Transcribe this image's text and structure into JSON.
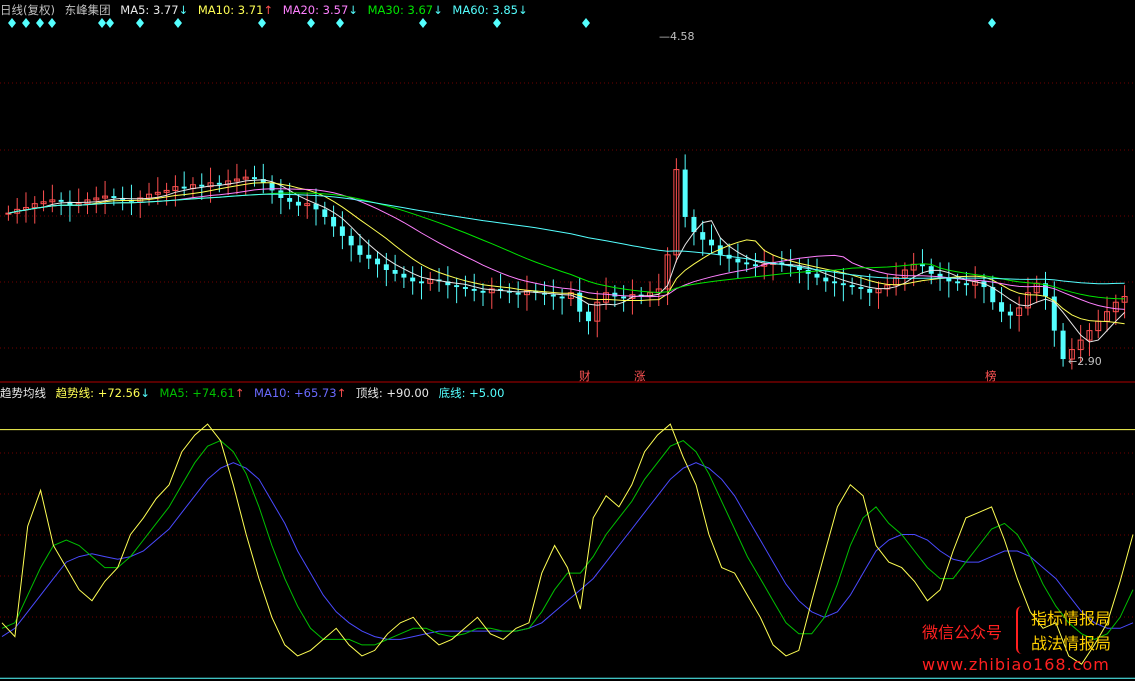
{
  "main_header": {
    "period": "日线(复权)",
    "stock_name": "东峰集团",
    "ma5_label": "MA5:",
    "ma5_value": "3.77",
    "ma5_arrow": "↓",
    "ma10_label": "MA10:",
    "ma10_value": "3.71",
    "ma10_arrow": "↑",
    "ma20_label": "MA20:",
    "ma20_value": "3.57",
    "ma20_arrow": "↓",
    "ma30_label": "MA30:",
    "ma30_value": "3.67",
    "ma30_arrow": "↓",
    "ma60_label": "MA60:",
    "ma60_value": "3.85",
    "ma60_arrow": "↓"
  },
  "indicator_header": {
    "name": "趋势均线",
    "trend_label": "趋势线:",
    "trend_value": "+72.56",
    "trend_arrow": "↓",
    "ma5_label": "MA5:",
    "ma5_value": "+74.61",
    "ma5_arrow": "↑",
    "ma10_label": "MA10:",
    "ma10_value": "+65.73",
    "ma10_arrow": "↑",
    "top_label": "顶线:",
    "top_value": "+90.00",
    "bottom_label": "底线:",
    "bottom_value": "+5.00"
  },
  "price_labels": {
    "high": "4.58",
    "low": "2.90"
  },
  "events": [
    {
      "label": "财"
    },
    {
      "label": "涨"
    },
    {
      "label": "榜"
    }
  ],
  "watermark": {
    "line1_prefix": "微信公众号",
    "line1_name": "指标情报局",
    "line2_name": "战法情报局",
    "url": "www.zhibiao168.com"
  },
  "colors": {
    "up": "#ff5050",
    "down": "#54ffff",
    "ma5": "#e8e8e8",
    "ma10": "#ffff54",
    "ma20": "#ff80ff",
    "ma30": "#00e600",
    "ma60": "#54ffff",
    "trend": "#ffff54",
    "trend_ma5": "#00c000",
    "trend_ma10": "#4a4aff",
    "panel_border": "#b00000",
    "grid": "#700000"
  },
  "chart_data": {
    "type": "candlestick",
    "price_high": 4.58,
    "price_low": 2.9,
    "indicator_top_line": 90,
    "indicator_bottom_line": 5,
    "candles_close": [
      3.72,
      3.74,
      3.75,
      3.77,
      3.78,
      3.79,
      3.78,
      3.76,
      3.77,
      3.79,
      3.8,
      3.81,
      3.8,
      3.79,
      3.78,
      3.8,
      3.82,
      3.83,
      3.84,
      3.86,
      3.85,
      3.87,
      3.86,
      3.88,
      3.87,
      3.89,
      3.9,
      3.91,
      3.9,
      3.88,
      3.84,
      3.8,
      3.78,
      3.76,
      3.77,
      3.74,
      3.7,
      3.65,
      3.6,
      3.55,
      3.5,
      3.48,
      3.45,
      3.42,
      3.4,
      3.38,
      3.36,
      3.35,
      3.37,
      3.36,
      3.34,
      3.33,
      3.32,
      3.31,
      3.3,
      3.32,
      3.31,
      3.3,
      3.29,
      3.31,
      3.3,
      3.29,
      3.28,
      3.27,
      3.3,
      3.2,
      3.15,
      3.25,
      3.3,
      3.28,
      3.27,
      3.29,
      3.28,
      3.3,
      3.32,
      3.5,
      3.95,
      3.7,
      3.62,
      3.58,
      3.55,
      3.5,
      3.48,
      3.46,
      3.45,
      3.44,
      3.45,
      3.46,
      3.45,
      3.44,
      3.42,
      3.4,
      3.38,
      3.36,
      3.35,
      3.34,
      3.33,
      3.32,
      3.3,
      3.32,
      3.34,
      3.38,
      3.42,
      3.45,
      3.44,
      3.4,
      3.38,
      3.36,
      3.35,
      3.34,
      3.36,
      3.33,
      3.25,
      3.2,
      3.18,
      3.22,
      3.3,
      3.35,
      3.28,
      3.1,
      2.95,
      3.0,
      3.05,
      3.1,
      3.15,
      3.2,
      3.25,
      3.28
    ],
    "trend_series": [
      20,
      15,
      55,
      68,
      48,
      40,
      32,
      28,
      35,
      40,
      52,
      58,
      65,
      70,
      82,
      88,
      92,
      86,
      70,
      52,
      36,
      22,
      12,
      8,
      10,
      14,
      18,
      12,
      8,
      10,
      16,
      20,
      22,
      16,
      12,
      14,
      18,
      22,
      16,
      14,
      18,
      20,
      38,
      48,
      40,
      25,
      58,
      66,
      62,
      70,
      82,
      88,
      92,
      80,
      70,
      52,
      40,
      38,
      30,
      22,
      12,
      8,
      10,
      28,
      45,
      62,
      70,
      66,
      48,
      42,
      40,
      35,
      28,
      32,
      46,
      58,
      60,
      62,
      50,
      36,
      24,
      18,
      20,
      8,
      5,
      12,
      20,
      35,
      52
    ],
    "trend_ma5_series": [
      18,
      20,
      30,
      40,
      48,
      50,
      48,
      44,
      40,
      40,
      44,
      50,
      56,
      62,
      70,
      78,
      84,
      86,
      82,
      74,
      62,
      48,
      36,
      26,
      18,
      14,
      14,
      14,
      12,
      12,
      14,
      16,
      18,
      18,
      16,
      15,
      16,
      18,
      18,
      17,
      17,
      18,
      24,
      32,
      38,
      38,
      44,
      52,
      58,
      64,
      72,
      78,
      84,
      86,
      82,
      74,
      64,
      54,
      44,
      36,
      28,
      20,
      16,
      16,
      22,
      34,
      48,
      58,
      62,
      56,
      52,
      46,
      40,
      36,
      36,
      42,
      48,
      54,
      56,
      52,
      44,
      34,
      26,
      20,
      16,
      14,
      16,
      22,
      32
    ],
    "trend_ma10_series": [
      15,
      18,
      24,
      30,
      36,
      42,
      44,
      45,
      44,
      43,
      44,
      46,
      50,
      54,
      60,
      66,
      72,
      76,
      78,
      76,
      72,
      64,
      56,
      46,
      38,
      30,
      24,
      20,
      17,
      15,
      14,
      14,
      15,
      16,
      17,
      17,
      17,
      17,
      17,
      17,
      17,
      18,
      20,
      24,
      28,
      32,
      36,
      42,
      48,
      54,
      60,
      66,
      72,
      76,
      78,
      76,
      72,
      66,
      58,
      50,
      42,
      34,
      28,
      24,
      22,
      24,
      30,
      38,
      46,
      50,
      52,
      52,
      50,
      46,
      43,
      42,
      42,
      44,
      46,
      46,
      44,
      40,
      36,
      30,
      24,
      20,
      18,
      18,
      20
    ]
  }
}
